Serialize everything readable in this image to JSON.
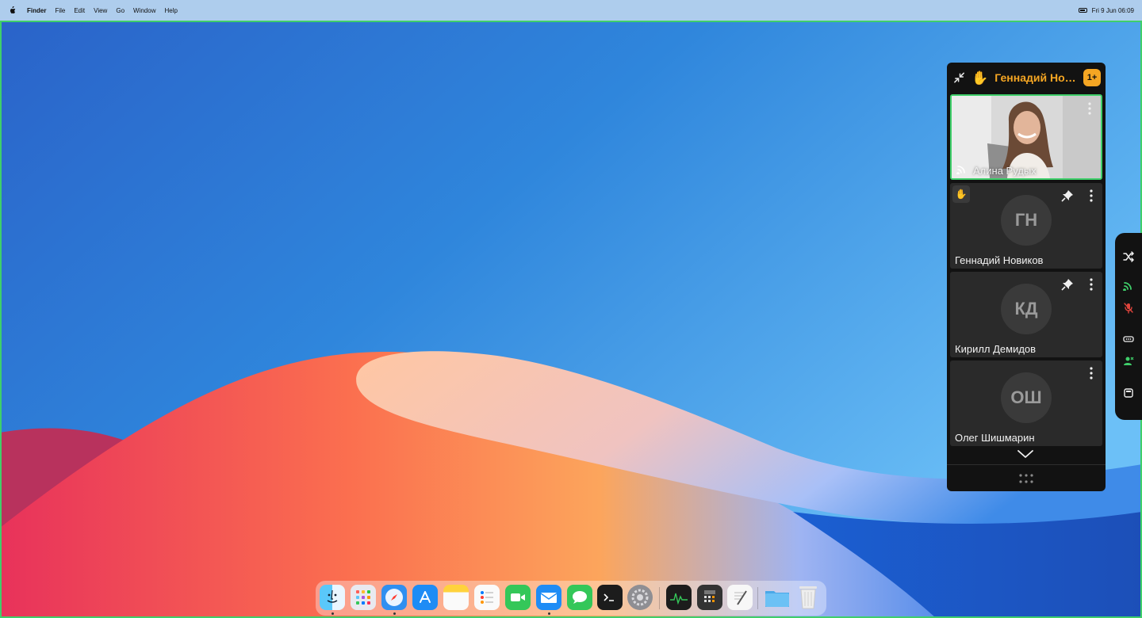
{
  "menubar": {
    "app_name": "Finder",
    "items": [
      "File",
      "Edit",
      "View",
      "Go",
      "Window",
      "Help"
    ],
    "clock": "Fri 9 Jun  06:09"
  },
  "call": {
    "raised_hand_name": "Геннадий Нов...",
    "raised_count": "1+",
    "participants": [
      {
        "name": "Алина Рудых",
        "initials": "",
        "active_speaker": true
      },
      {
        "name": "Геннадий Новиков",
        "initials": "ГН",
        "pinned": true,
        "hand_raised": true
      },
      {
        "name": "Кирилл Демидов",
        "initials": "КД",
        "pinned": true
      },
      {
        "name": "Олег Шишмарин",
        "initials": "ОШ"
      }
    ]
  },
  "colors": {
    "accent_orange": "#f5a623",
    "speaker_border": "#3fcf6a",
    "panel_bg": "#121212",
    "tile_bg": "#2a2a2a",
    "mic_muted": "#e0443c",
    "cast_green": "#3fcf6a"
  },
  "side_toolbar": [
    "shuffle-icon",
    "cast-icon",
    "mic-muted-icon",
    "captions-icon",
    "participants-icon",
    "window-icon"
  ],
  "dock": {
    "apps": [
      "finder",
      "launchpad",
      "safari",
      "app-store",
      "notes",
      "reminders",
      "facetime",
      "mail",
      "messages",
      "terminal",
      "system-settings",
      "activity-monitor",
      "calculator",
      "textedit",
      "folder",
      "trash"
    ]
  }
}
